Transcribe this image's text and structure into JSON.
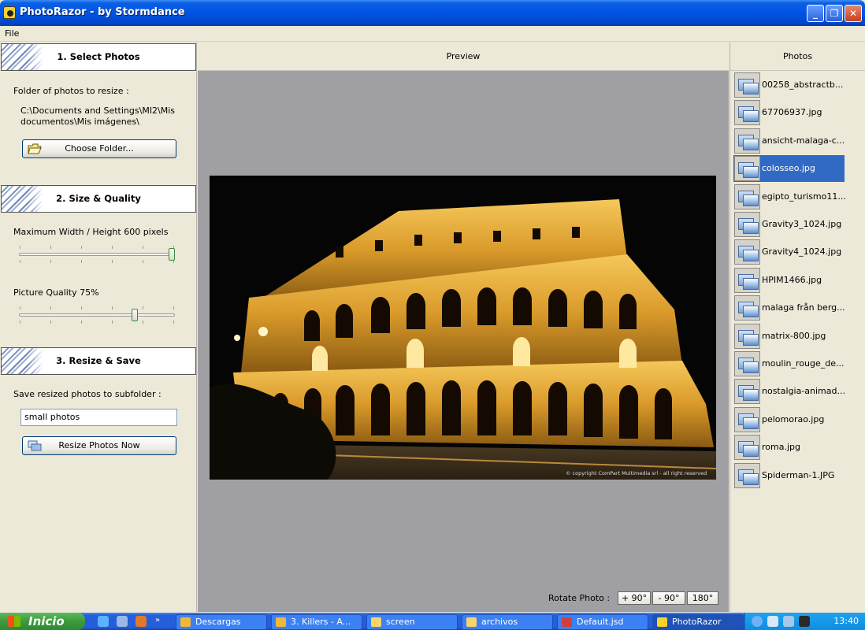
{
  "window": {
    "title": "PhotoRazor - by Stormdance",
    "buttons": {
      "minimize": "_",
      "maximize": "❐",
      "close": "✕"
    }
  },
  "menu": {
    "file": "File"
  },
  "left": {
    "step1": {
      "title": "1. Select Photos",
      "folder_label": "Folder of photos to resize :",
      "folder_path": "C:\\Documents and Settings\\MI2\\Mis documentos\\Mis imágenes\\",
      "choose_button": "Choose Folder..."
    },
    "step2": {
      "title": "2. Size & Quality",
      "size_label": "Maximum Width / Height 600 pixels",
      "size_value_fraction": 1.0,
      "quality_label": "Picture Quality 75%",
      "quality_value_percent": 75
    },
    "step3": {
      "title": "3. Resize & Save",
      "subfolder_label": "Save resized photos to subfolder :",
      "subfolder_value": "small photos",
      "resize_button": "Resize Photos Now"
    }
  },
  "preview": {
    "header": "Preview",
    "copyright": "© copyright ComPart Multimedia srl - all right reserved",
    "rotate_label": "Rotate Photo :",
    "rotate_buttons": [
      "+ 90°",
      "- 90°",
      "180°"
    ]
  },
  "photos": {
    "header": "Photos",
    "selected_index": 3,
    "items": [
      "00258_abstractb...",
      "67706937.jpg",
      "ansicht-malaga-c...",
      "colosseo.jpg",
      "egipto_turismo11...",
      "Gravity3_1024.jpg",
      "Gravity4_1024.jpg",
      "HPIM1466.jpg",
      "malaga från berg...",
      "matrix-800.jpg",
      "moulin_rouge_de...",
      "nostalgia-animad...",
      "pelomorao.jpg",
      "roma.jpg",
      "Spiderman-1.JPG"
    ]
  },
  "taskbar": {
    "start": "Inicio",
    "tasks": [
      "Descargas",
      "3. Killers - A...",
      "screen",
      "archivos",
      "Default.jsd",
      "PhotoRazor"
    ],
    "clock": "13:40"
  }
}
